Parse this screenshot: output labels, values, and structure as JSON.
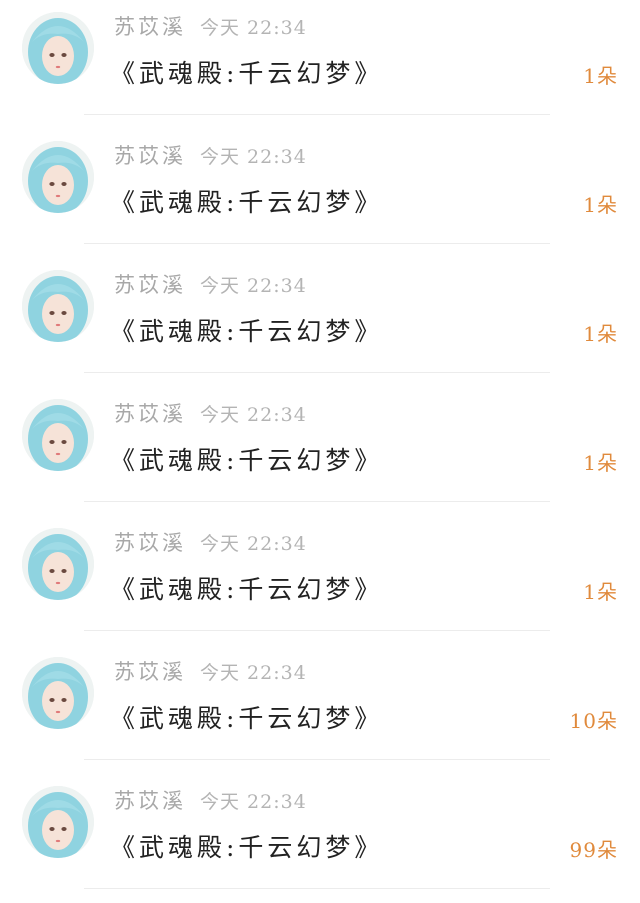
{
  "messages": [
    {
      "sender": "苏苡溪",
      "time": "今天 22:34",
      "text": "《武魂殿:千云幻梦》",
      "flowers": "1朵"
    },
    {
      "sender": "苏苡溪",
      "time": "今天 22:34",
      "text": "《武魂殿:千云幻梦》",
      "flowers": "1朵"
    },
    {
      "sender": "苏苡溪",
      "time": "今天 22:34",
      "text": "《武魂殿:千云幻梦》",
      "flowers": "1朵"
    },
    {
      "sender": "苏苡溪",
      "time": "今天 22:34",
      "text": "《武魂殿:千云幻梦》",
      "flowers": "1朵"
    },
    {
      "sender": "苏苡溪",
      "time": "今天 22:34",
      "text": "《武魂殿:千云幻梦》",
      "flowers": "1朵"
    },
    {
      "sender": "苏苡溪",
      "time": "今天 22:34",
      "text": "《武魂殿:千云幻梦》",
      "flowers": "10朵"
    },
    {
      "sender": "苏苡溪",
      "time": "今天 22:34",
      "text": "《武魂殿:千云幻梦》",
      "flowers": "99朵"
    }
  ],
  "colors": {
    "sender": "#a8a8a8",
    "time": "#b4b4b4",
    "message": "#222222",
    "flower_count": "#e08a3c",
    "divider": "#ececec"
  },
  "avatar_icon": "anime-girl-avatar-icon"
}
